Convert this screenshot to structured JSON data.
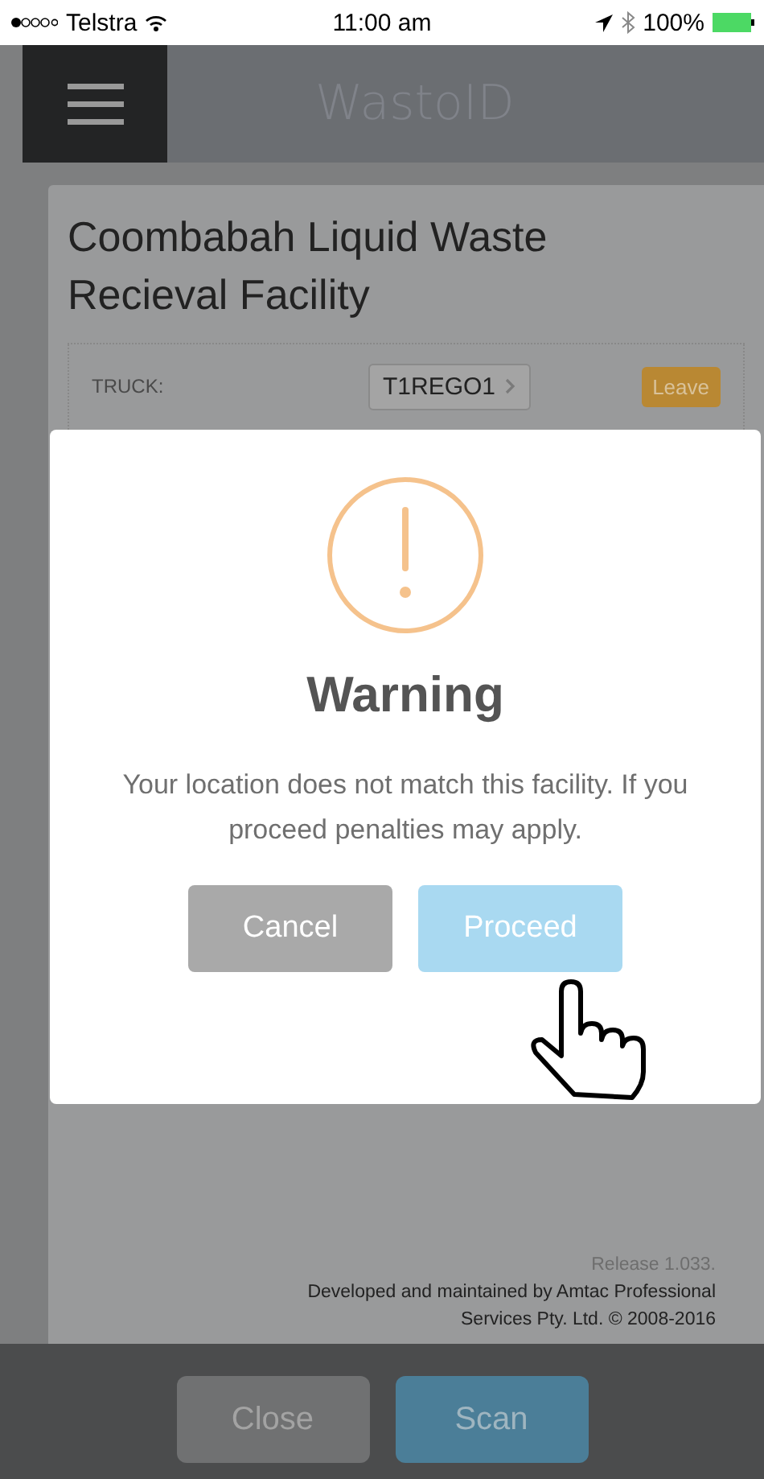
{
  "status_bar": {
    "carrier": "Telstra",
    "time": "11:00 am",
    "battery": "100%"
  },
  "header": {
    "title": "WastoID"
  },
  "facility": {
    "title": "Coombabah Liquid Waste Recieval Facility",
    "fields": [
      {
        "label": "TRUCK:",
        "value": "T1REGO1"
      }
    ],
    "leave_button": "Leave"
  },
  "dialog": {
    "title": "Warning",
    "message": "Your location does not match this facility. If you proceed penalties may apply.",
    "buttons": [
      {
        "label": "Cancel",
        "kind": "cancel"
      },
      {
        "label": "Proceed",
        "kind": "confirm"
      }
    ]
  },
  "footer": {
    "release": "Release 1.033.",
    "credit": "Developed and maintained by Amtac Professional Services Pty. Ltd. © 2008-2016"
  },
  "bottom_buttons": [
    {
      "label": "Close",
      "kind": "secondary"
    },
    {
      "label": "Scan",
      "kind": "primary"
    }
  ]
}
